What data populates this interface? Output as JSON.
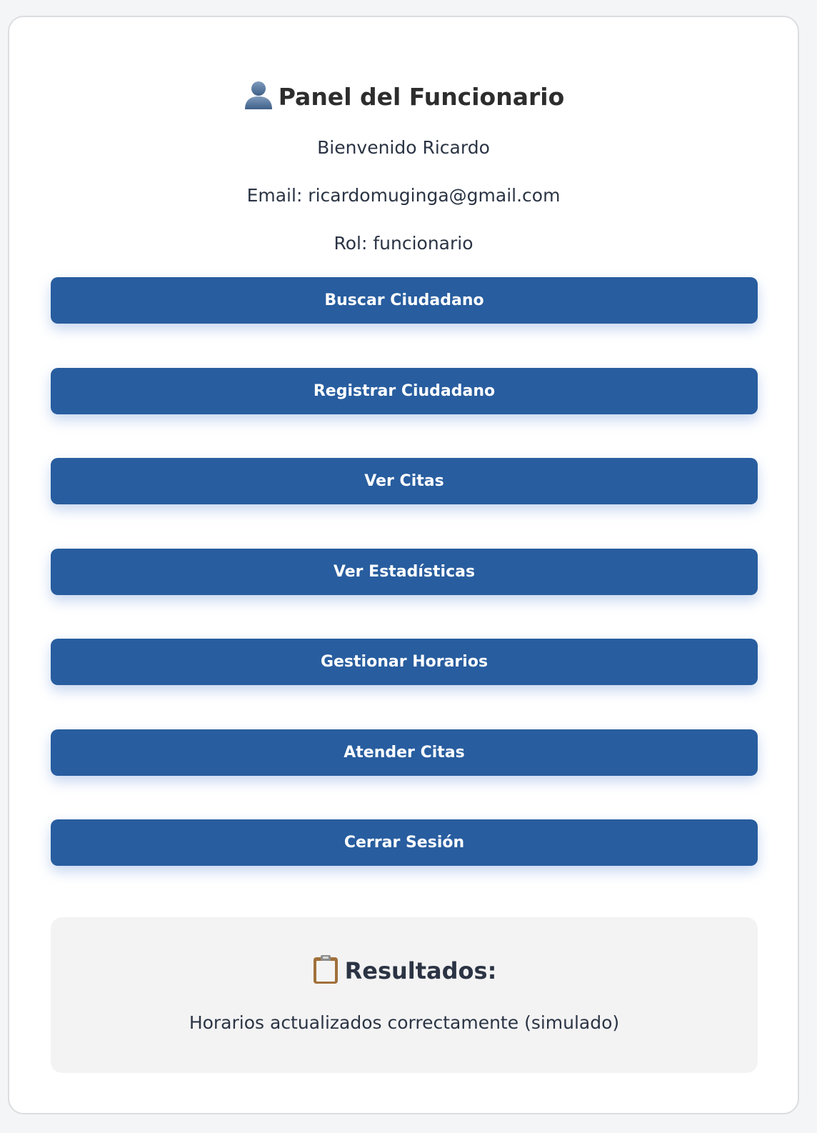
{
  "header": {
    "title": "Panel del Funcionario",
    "title_icon": "user-silhouette-icon"
  },
  "user": {
    "welcome": "Bienvenido Ricardo",
    "email": "Email: ricardomuginga@gmail.com",
    "role": "Rol: funcionario"
  },
  "actions": {
    "buscar_ciudadano": "Buscar Ciudadano",
    "registrar_ciudadano": "Registrar Ciudadano",
    "ver_citas": "Ver Citas",
    "ver_estadisticas": "Ver Estadísticas",
    "gestionar_horarios": "Gestionar Horarios",
    "atender_citas": "Atender Citas",
    "cerrar_sesion": "Cerrar Sesión"
  },
  "results": {
    "title": "Resultados:",
    "title_icon": "clipboard-icon",
    "message": "Horarios actualizados correctamente (simulado)"
  },
  "colors": {
    "primary_button": "#285d9f",
    "text": "#2b3444",
    "results_background": "#f3f3f4"
  }
}
